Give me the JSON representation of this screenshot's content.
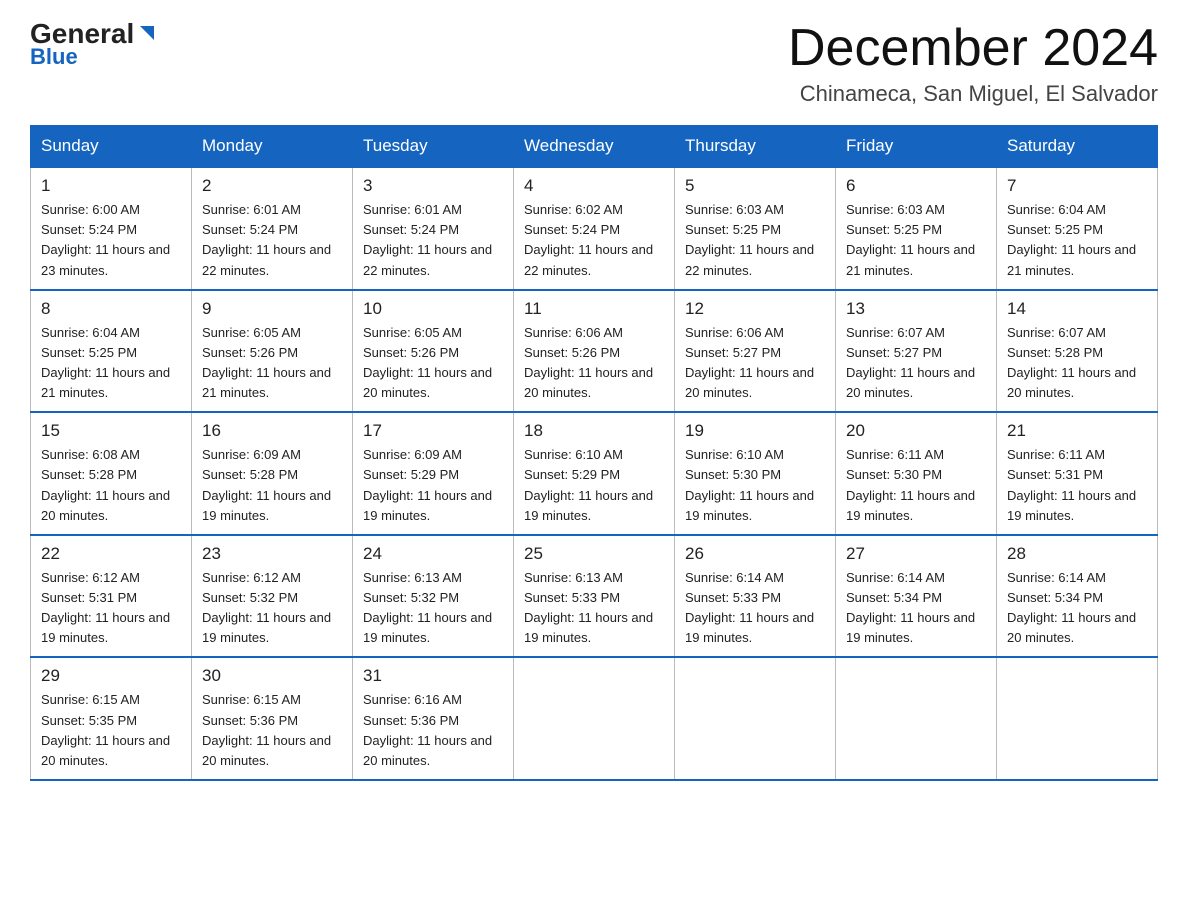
{
  "header": {
    "logo_general": "General",
    "logo_blue": "Blue",
    "month_title": "December 2024",
    "location": "Chinameca, San Miguel, El Salvador"
  },
  "days_of_week": [
    "Sunday",
    "Monday",
    "Tuesday",
    "Wednesday",
    "Thursday",
    "Friday",
    "Saturday"
  ],
  "weeks": [
    [
      {
        "day": "1",
        "sunrise": "6:00 AM",
        "sunset": "5:24 PM",
        "daylight": "11 hours and 23 minutes."
      },
      {
        "day": "2",
        "sunrise": "6:01 AM",
        "sunset": "5:24 PM",
        "daylight": "11 hours and 22 minutes."
      },
      {
        "day": "3",
        "sunrise": "6:01 AM",
        "sunset": "5:24 PM",
        "daylight": "11 hours and 22 minutes."
      },
      {
        "day": "4",
        "sunrise": "6:02 AM",
        "sunset": "5:24 PM",
        "daylight": "11 hours and 22 minutes."
      },
      {
        "day": "5",
        "sunrise": "6:03 AM",
        "sunset": "5:25 PM",
        "daylight": "11 hours and 22 minutes."
      },
      {
        "day": "6",
        "sunrise": "6:03 AM",
        "sunset": "5:25 PM",
        "daylight": "11 hours and 21 minutes."
      },
      {
        "day": "7",
        "sunrise": "6:04 AM",
        "sunset": "5:25 PM",
        "daylight": "11 hours and 21 minutes."
      }
    ],
    [
      {
        "day": "8",
        "sunrise": "6:04 AM",
        "sunset": "5:25 PM",
        "daylight": "11 hours and 21 minutes."
      },
      {
        "day": "9",
        "sunrise": "6:05 AM",
        "sunset": "5:26 PM",
        "daylight": "11 hours and 21 minutes."
      },
      {
        "day": "10",
        "sunrise": "6:05 AM",
        "sunset": "5:26 PM",
        "daylight": "11 hours and 20 minutes."
      },
      {
        "day": "11",
        "sunrise": "6:06 AM",
        "sunset": "5:26 PM",
        "daylight": "11 hours and 20 minutes."
      },
      {
        "day": "12",
        "sunrise": "6:06 AM",
        "sunset": "5:27 PM",
        "daylight": "11 hours and 20 minutes."
      },
      {
        "day": "13",
        "sunrise": "6:07 AM",
        "sunset": "5:27 PM",
        "daylight": "11 hours and 20 minutes."
      },
      {
        "day": "14",
        "sunrise": "6:07 AM",
        "sunset": "5:28 PM",
        "daylight": "11 hours and 20 minutes."
      }
    ],
    [
      {
        "day": "15",
        "sunrise": "6:08 AM",
        "sunset": "5:28 PM",
        "daylight": "11 hours and 20 minutes."
      },
      {
        "day": "16",
        "sunrise": "6:09 AM",
        "sunset": "5:28 PM",
        "daylight": "11 hours and 19 minutes."
      },
      {
        "day": "17",
        "sunrise": "6:09 AM",
        "sunset": "5:29 PM",
        "daylight": "11 hours and 19 minutes."
      },
      {
        "day": "18",
        "sunrise": "6:10 AM",
        "sunset": "5:29 PM",
        "daylight": "11 hours and 19 minutes."
      },
      {
        "day": "19",
        "sunrise": "6:10 AM",
        "sunset": "5:30 PM",
        "daylight": "11 hours and 19 minutes."
      },
      {
        "day": "20",
        "sunrise": "6:11 AM",
        "sunset": "5:30 PM",
        "daylight": "11 hours and 19 minutes."
      },
      {
        "day": "21",
        "sunrise": "6:11 AM",
        "sunset": "5:31 PM",
        "daylight": "11 hours and 19 minutes."
      }
    ],
    [
      {
        "day": "22",
        "sunrise": "6:12 AM",
        "sunset": "5:31 PM",
        "daylight": "11 hours and 19 minutes."
      },
      {
        "day": "23",
        "sunrise": "6:12 AM",
        "sunset": "5:32 PM",
        "daylight": "11 hours and 19 minutes."
      },
      {
        "day": "24",
        "sunrise": "6:13 AM",
        "sunset": "5:32 PM",
        "daylight": "11 hours and 19 minutes."
      },
      {
        "day": "25",
        "sunrise": "6:13 AM",
        "sunset": "5:33 PM",
        "daylight": "11 hours and 19 minutes."
      },
      {
        "day": "26",
        "sunrise": "6:14 AM",
        "sunset": "5:33 PM",
        "daylight": "11 hours and 19 minutes."
      },
      {
        "day": "27",
        "sunrise": "6:14 AM",
        "sunset": "5:34 PM",
        "daylight": "11 hours and 19 minutes."
      },
      {
        "day": "28",
        "sunrise": "6:14 AM",
        "sunset": "5:34 PM",
        "daylight": "11 hours and 20 minutes."
      }
    ],
    [
      {
        "day": "29",
        "sunrise": "6:15 AM",
        "sunset": "5:35 PM",
        "daylight": "11 hours and 20 minutes."
      },
      {
        "day": "30",
        "sunrise": "6:15 AM",
        "sunset": "5:36 PM",
        "daylight": "11 hours and 20 minutes."
      },
      {
        "day": "31",
        "sunrise": "6:16 AM",
        "sunset": "5:36 PM",
        "daylight": "11 hours and 20 minutes."
      },
      null,
      null,
      null,
      null
    ]
  ],
  "labels": {
    "sunrise": "Sunrise:",
    "sunset": "Sunset:",
    "daylight": "Daylight:"
  }
}
